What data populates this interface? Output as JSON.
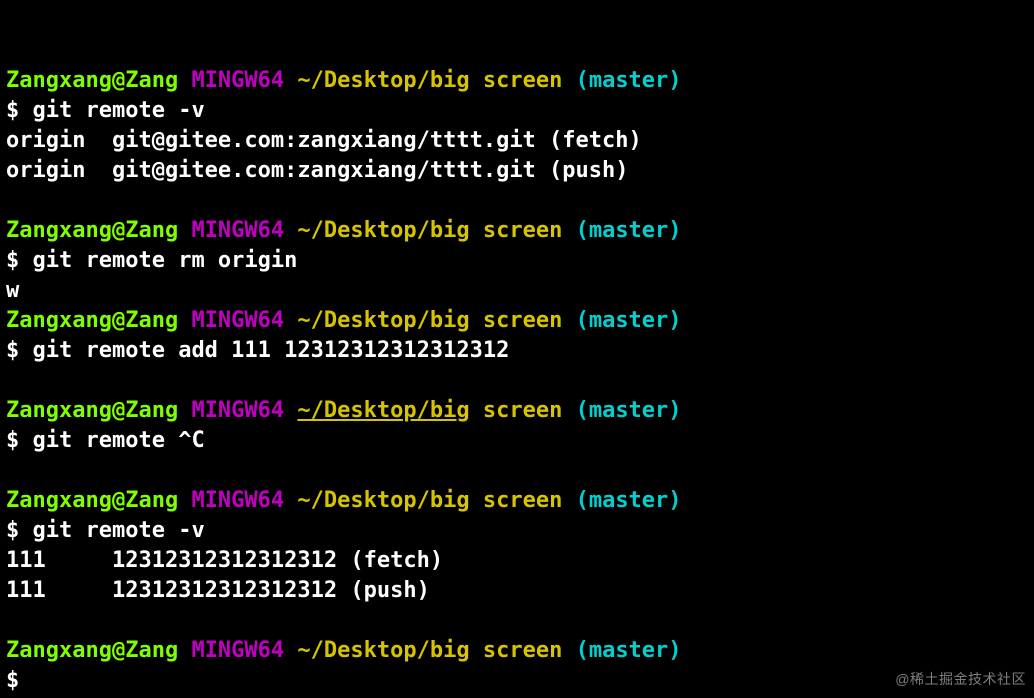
{
  "prompt": {
    "user": "Zangxang@Zang",
    "env": "MINGW64",
    "path": "~/Desktop/big",
    "path_tail": "screen",
    "branch": "(master)",
    "dollar": "$"
  },
  "blocks": [
    {
      "cmd": "git remote -v",
      "output": [
        "origin  git@gitee.com:zangxiang/tttt.git (fetch)",
        "origin  git@gitee.com:zangxiang/tttt.git (push)"
      ],
      "prompt_path_underline": false
    },
    {
      "cmd": "git remote rm origin",
      "output": [
        "w"
      ],
      "trailing_blank": false,
      "prompt_path_underline": false
    },
    {
      "cmd": "git remote add 111 12312312312312312",
      "output": [],
      "prompt_path_underline": false
    },
    {
      "cmd": "git remote ^C",
      "output": [],
      "prompt_path_underline": true
    },
    {
      "cmd": "git remote -v",
      "output": [
        "111     12312312312312312 (fetch)",
        "111     12312312312312312 (push)"
      ],
      "prompt_path_underline": false
    }
  ],
  "final_prompt_empty_cmd": true,
  "watermark": "@稀土掘金技术社区"
}
